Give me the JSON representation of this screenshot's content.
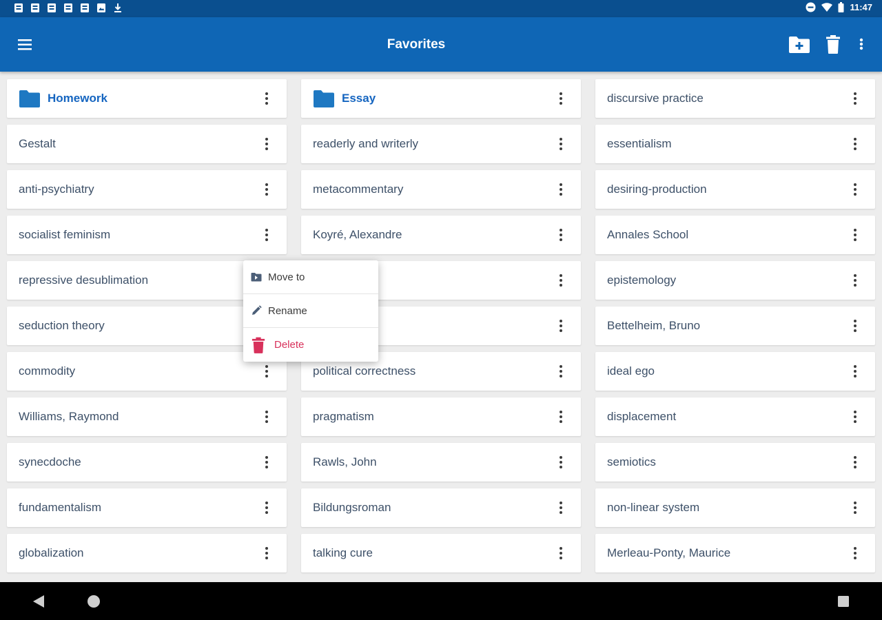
{
  "status_bar": {
    "notification_icons": [
      "notification-icon",
      "notification-icon",
      "notification-icon",
      "notification-icon",
      "notification-icon",
      "image-notification-icon",
      "download-notification-icon"
    ],
    "time": "11:47"
  },
  "app_bar": {
    "title": "Favorites",
    "actions": [
      "new-folder-icon",
      "delete-icon",
      "more-vert-icon"
    ]
  },
  "columns": [
    [
      {
        "label": "Homework",
        "folder": true
      },
      {
        "label": "Gestalt"
      },
      {
        "label": "anti-psychiatry"
      },
      {
        "label": "socialist feminism"
      },
      {
        "label": "repressive desublimation"
      },
      {
        "label": "seduction theory"
      },
      {
        "label": "commodity"
      },
      {
        "label": "Williams, Raymond"
      },
      {
        "label": "synecdoche"
      },
      {
        "label": "fundamentalism"
      },
      {
        "label": "globalization"
      }
    ],
    [
      {
        "label": "Essay",
        "folder": true
      },
      {
        "label": "readerly and writerly"
      },
      {
        "label": "metacommentary"
      },
      {
        "label": "Koyré, Alexandre"
      },
      {
        "label": ""
      },
      {
        "label": ""
      },
      {
        "label": "political correctness"
      },
      {
        "label": "pragmatism"
      },
      {
        "label": "Rawls, John"
      },
      {
        "label": "Bildungsroman"
      },
      {
        "label": "talking cure"
      }
    ],
    [
      {
        "label": "discursive practice"
      },
      {
        "label": "essentialism"
      },
      {
        "label": "desiring-production"
      },
      {
        "label": "Annales School"
      },
      {
        "label": "epistemology"
      },
      {
        "label": "Bettelheim, Bruno"
      },
      {
        "label": "ideal ego"
      },
      {
        "label": "displacement"
      },
      {
        "label": "semiotics"
      },
      {
        "label": "non-linear system"
      },
      {
        "label": "Merleau-Ponty, Maurice"
      }
    ]
  ],
  "context_menu": {
    "items": [
      {
        "label": "Move to",
        "icon": "move-to-folder-icon"
      },
      {
        "label": "Rename",
        "icon": "pencil-icon"
      },
      {
        "label": "Delete",
        "icon": "trash-icon",
        "danger": true
      }
    ]
  },
  "nav_bar": {
    "buttons": [
      "back-icon",
      "home-icon",
      "recents-icon"
    ]
  },
  "colors": {
    "status_bar": "#0a4f8f",
    "app_bar": "#0f66b5",
    "folder": "#1e78c2",
    "folder_label": "#1565c0",
    "item_text": "#3d5068",
    "danger": "#d8315b",
    "background": "#ededed"
  }
}
